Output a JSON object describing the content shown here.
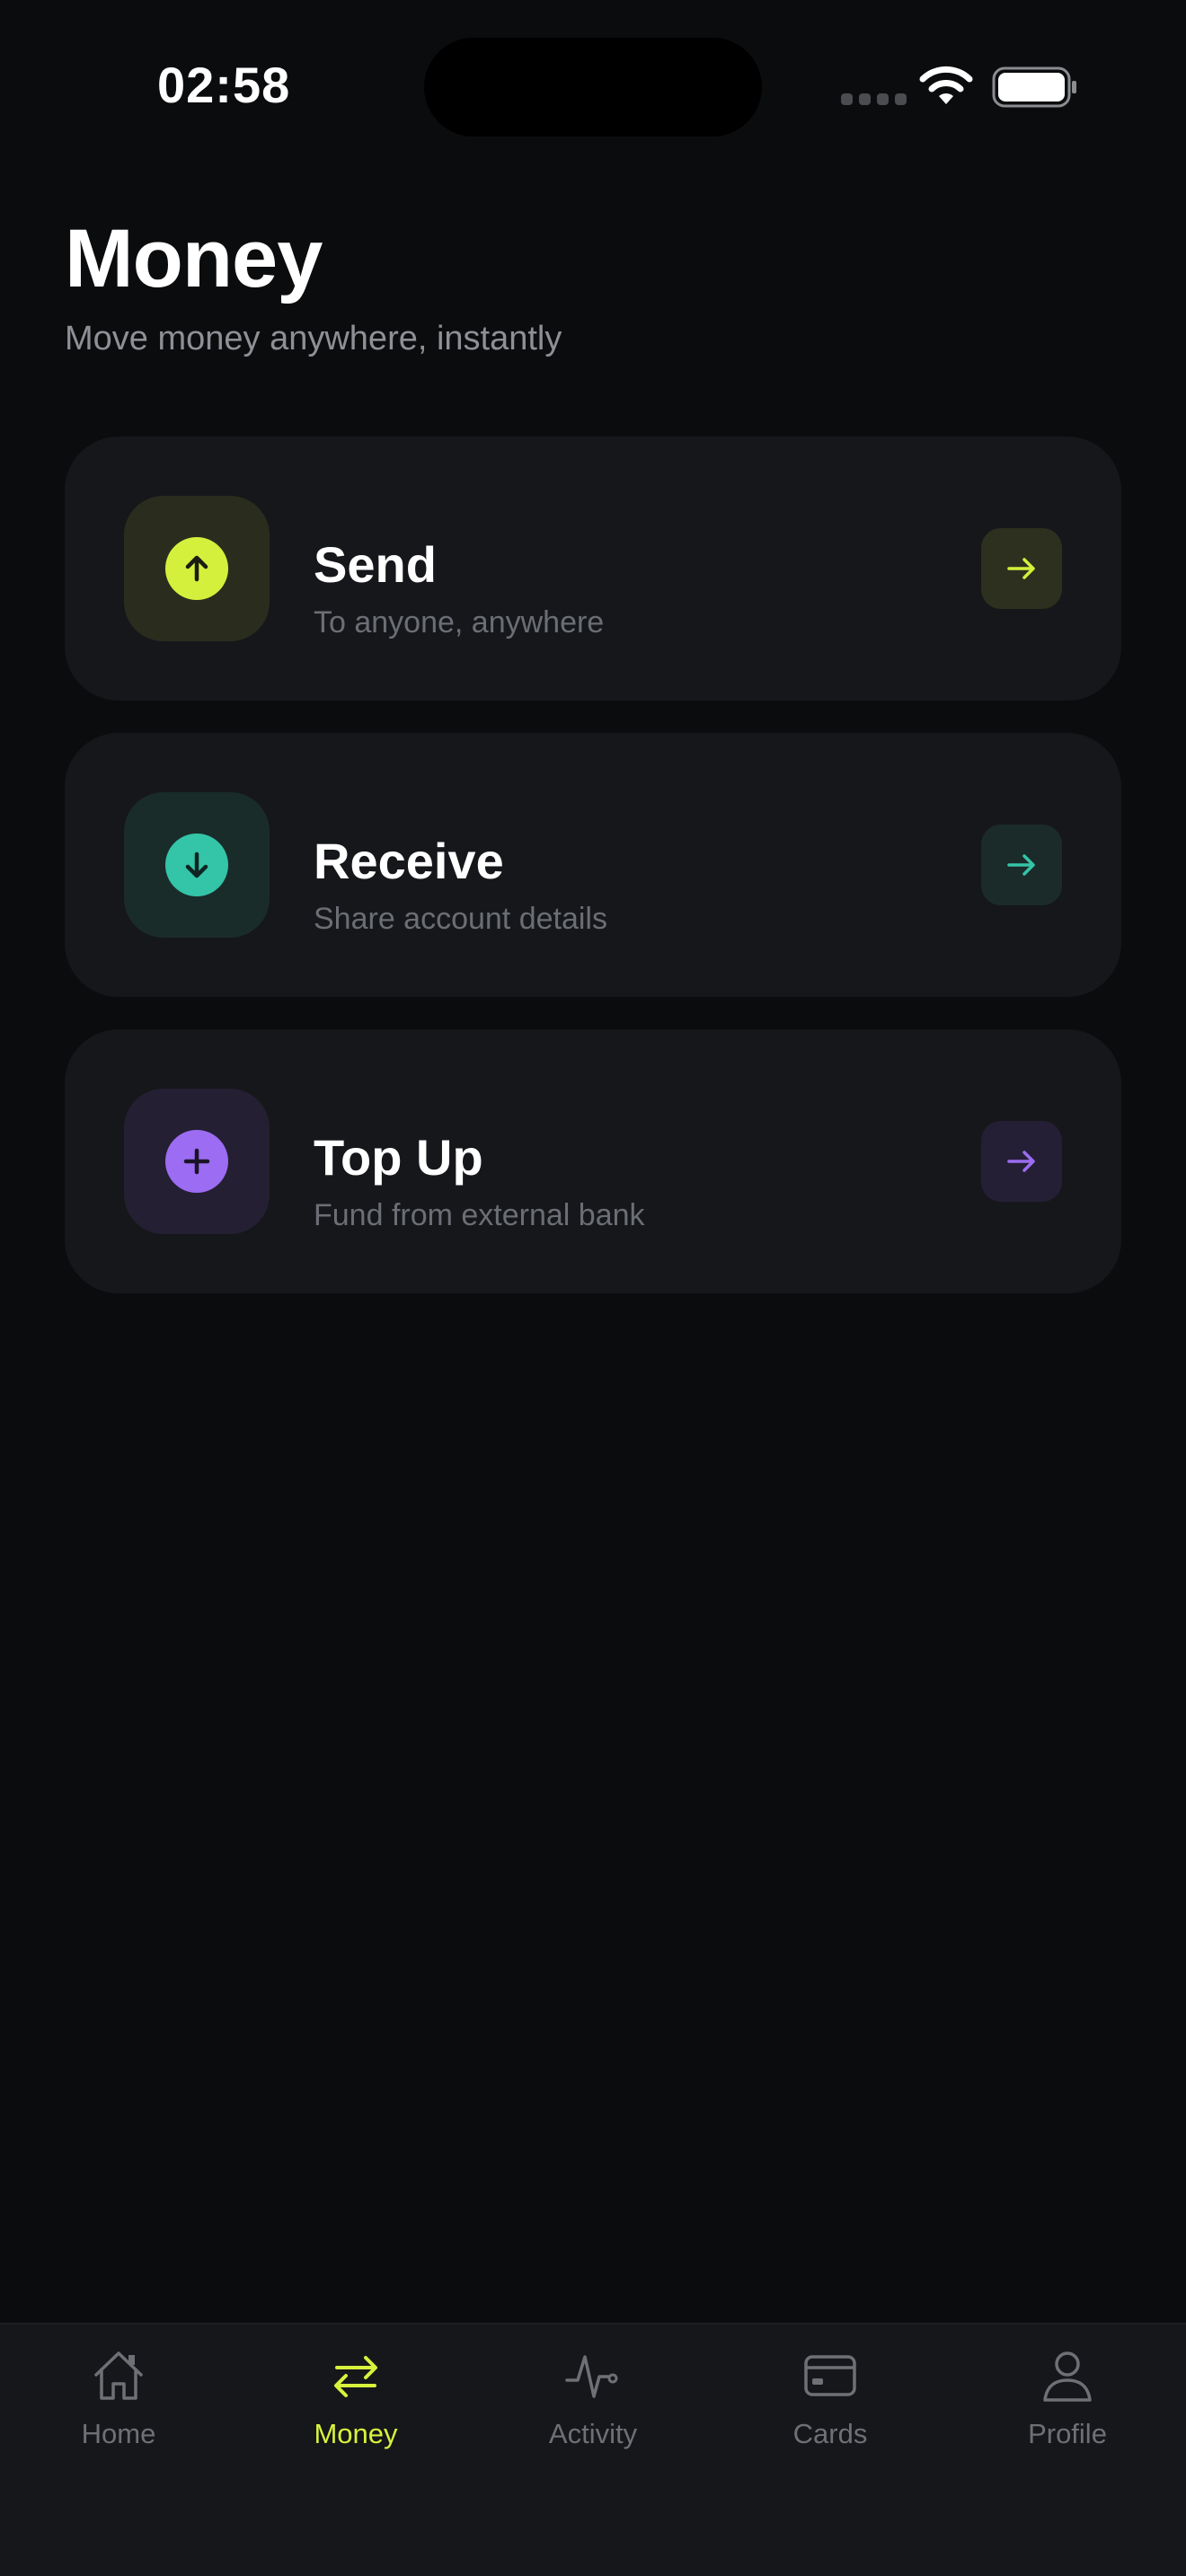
{
  "status_bar": {
    "time": "02:58"
  },
  "header": {
    "title": "Money",
    "subtitle": "Move money anywhere, instantly"
  },
  "actions": [
    {
      "label": "Send",
      "description": "To anyone, anywhere",
      "icon": "arrow-up-icon",
      "accent": "#d4f03c",
      "tile_bg": "#2a2d1e",
      "go_bg": "#2d301f"
    },
    {
      "label": "Receive",
      "description": "Share account details",
      "icon": "arrow-down-icon",
      "accent": "#34c4a8",
      "tile_bg": "#1a2c2a",
      "go_bg": "#1b2b29"
    },
    {
      "label": "Top Up",
      "description": "Fund from external bank",
      "icon": "plus-icon",
      "accent": "#9c6cf2",
      "tile_bg": "#241f33",
      "go_bg": "#251f35"
    }
  ],
  "tabbar": {
    "active": "Money",
    "active_color": "#d8f23c",
    "items": [
      {
        "label": "Home",
        "icon": "home-icon"
      },
      {
        "label": "Money",
        "icon": "transfer-icon"
      },
      {
        "label": "Activity",
        "icon": "activity-icon"
      },
      {
        "label": "Cards",
        "icon": "card-icon"
      },
      {
        "label": "Profile",
        "icon": "profile-icon"
      }
    ]
  }
}
